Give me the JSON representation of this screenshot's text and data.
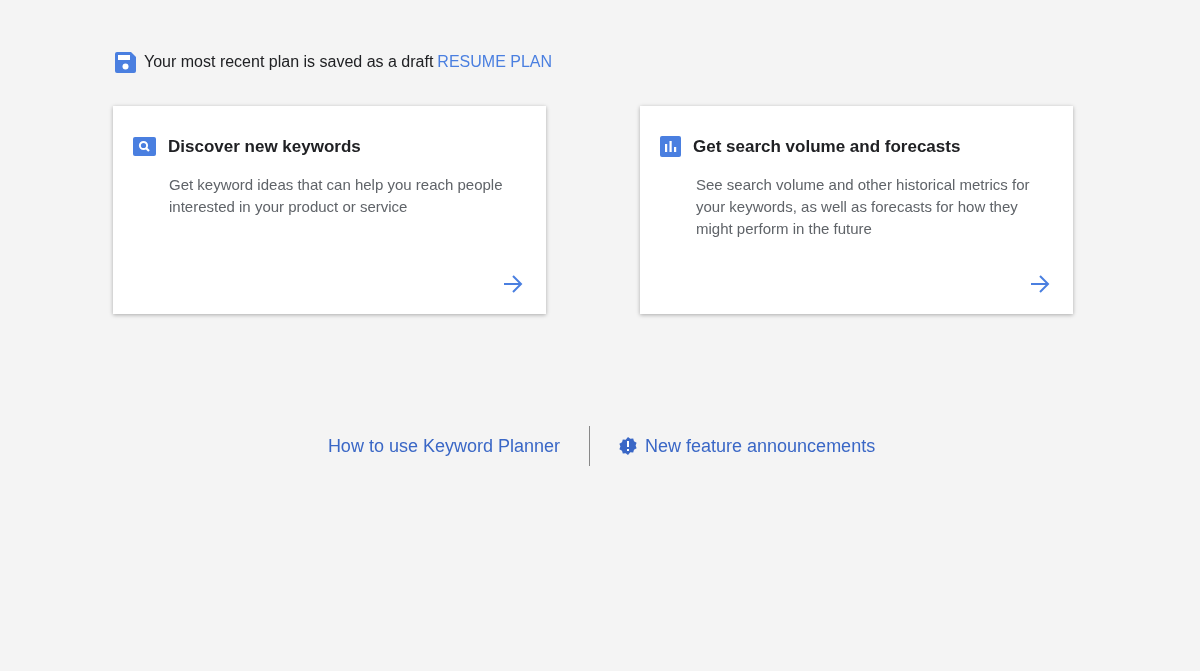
{
  "draft_banner": {
    "message": "Your most recent plan is saved as a draft",
    "link": "RESUME PLAN"
  },
  "cards": [
    {
      "kind": "search",
      "title": "Discover new keywords",
      "description": "Get keyword ideas that can help you reach people interested in your product or service"
    },
    {
      "kind": "chart",
      "title": "Get search volume and forecasts",
      "description": "See search volume and other historical metrics for your keywords, as well as forecasts for how they might perform in the future"
    }
  ],
  "footer_links": [
    {
      "label": "How to use Keyword Planner",
      "icon": false
    },
    {
      "label": "New feature announcements",
      "icon": true
    }
  ]
}
